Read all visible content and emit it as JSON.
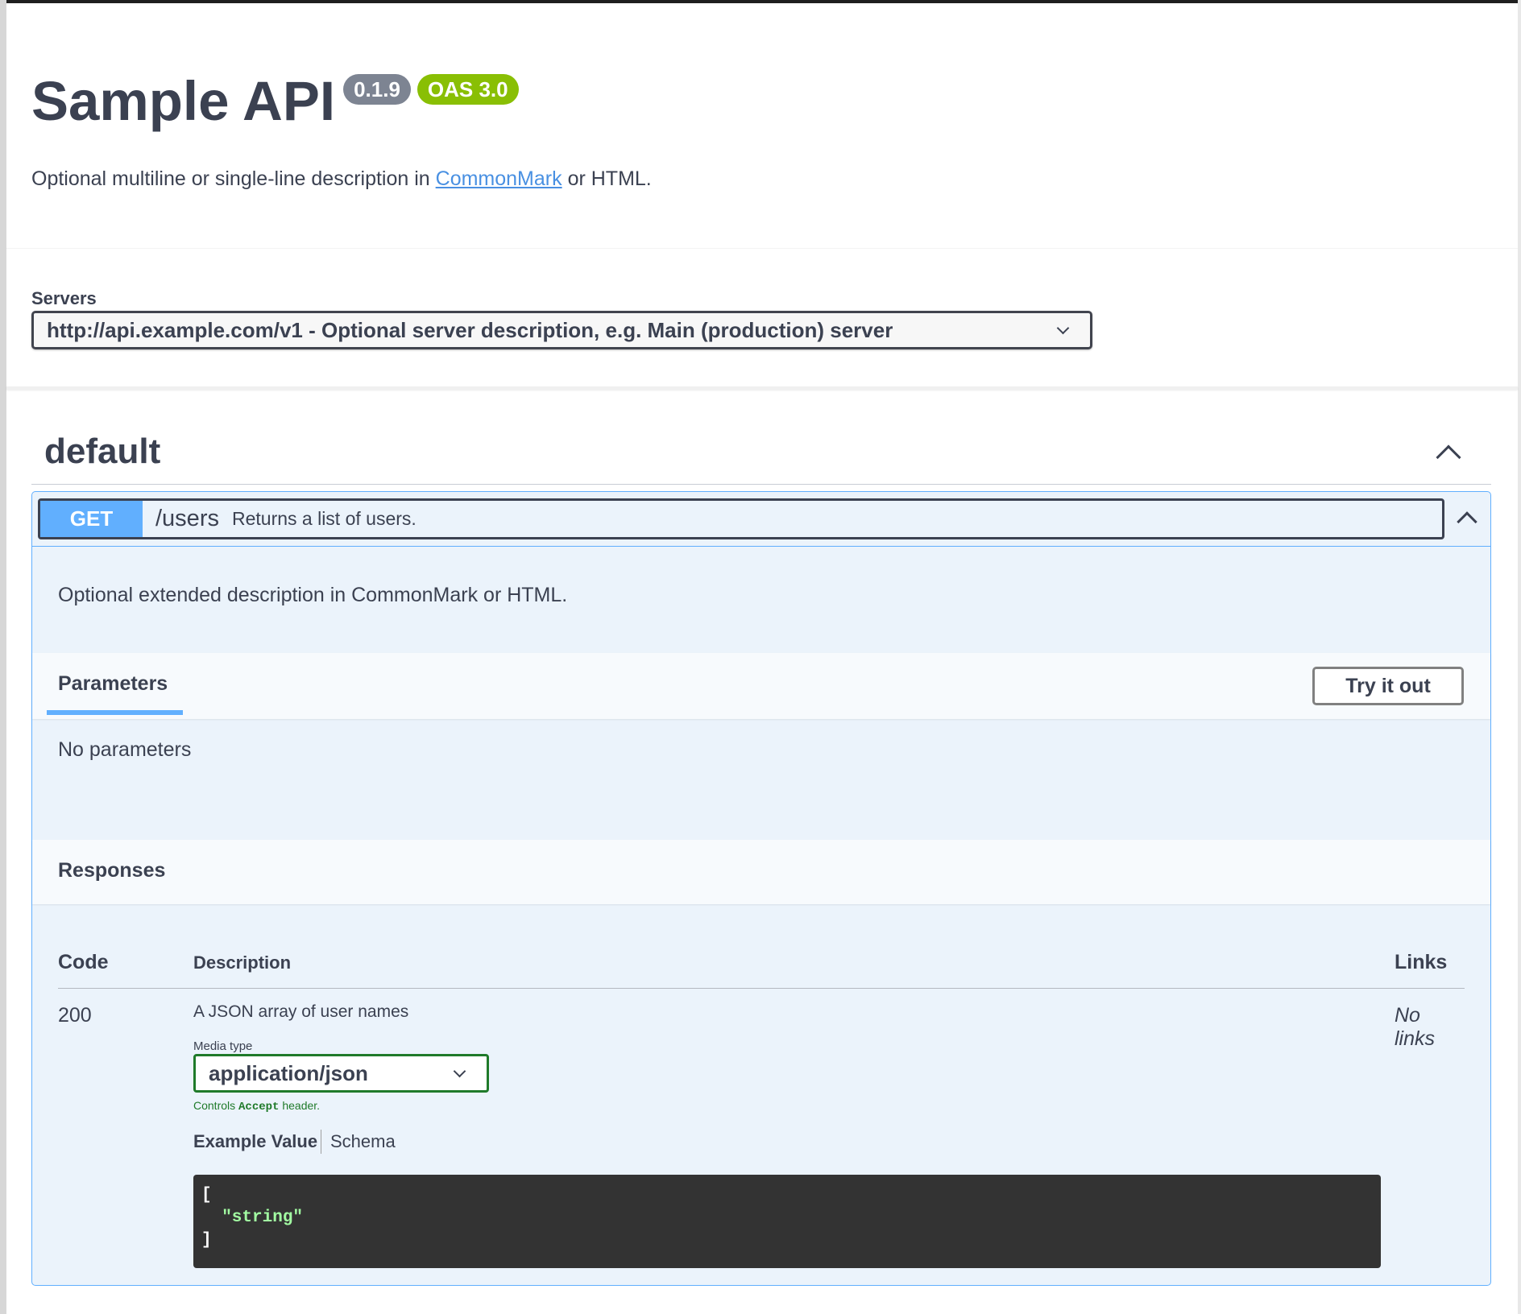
{
  "info": {
    "title": "Sample API",
    "version_badge": "0.1.9",
    "oas_badge": "OAS 3.0",
    "description_before": "Optional multiline or single-line description in ",
    "description_link": "CommonMark",
    "description_after": " or HTML."
  },
  "servers": {
    "label": "Servers",
    "selected": "http://api.example.com/v1 - Optional server description, e.g. Main (production) server"
  },
  "tag": {
    "name": "default"
  },
  "operation": {
    "method": "GET",
    "path": "/users",
    "summary": "Returns a list of users.",
    "description": "Optional extended description in CommonMark or HTML.",
    "parameters_tab": "Parameters",
    "try_it_out": "Try it out",
    "no_parameters": "No parameters",
    "responses_title": "Responses",
    "responses": {
      "headers": {
        "code": "Code",
        "description": "Description",
        "links": "Links"
      },
      "rows": [
        {
          "code": "200",
          "description": "A JSON array of user names",
          "links": "No links",
          "media_type_label": "Media type",
          "media_type": "application/json",
          "media_hint_before": "Controls ",
          "media_hint_code": "Accept",
          "media_hint_after": " header.",
          "tab_example": "Example Value",
          "tab_schema": "Schema",
          "example_lines": [
            "[",
            "  \"string\"",
            "]"
          ]
        }
      ]
    }
  },
  "colors": {
    "get_method": "#61affe",
    "oas_badge": "#89bf04",
    "version_badge": "#7d8492",
    "link": "#4990e2",
    "media_select_border": "#1f7a2a",
    "code_bg": "#333333",
    "code_string": "#a2fca2"
  }
}
